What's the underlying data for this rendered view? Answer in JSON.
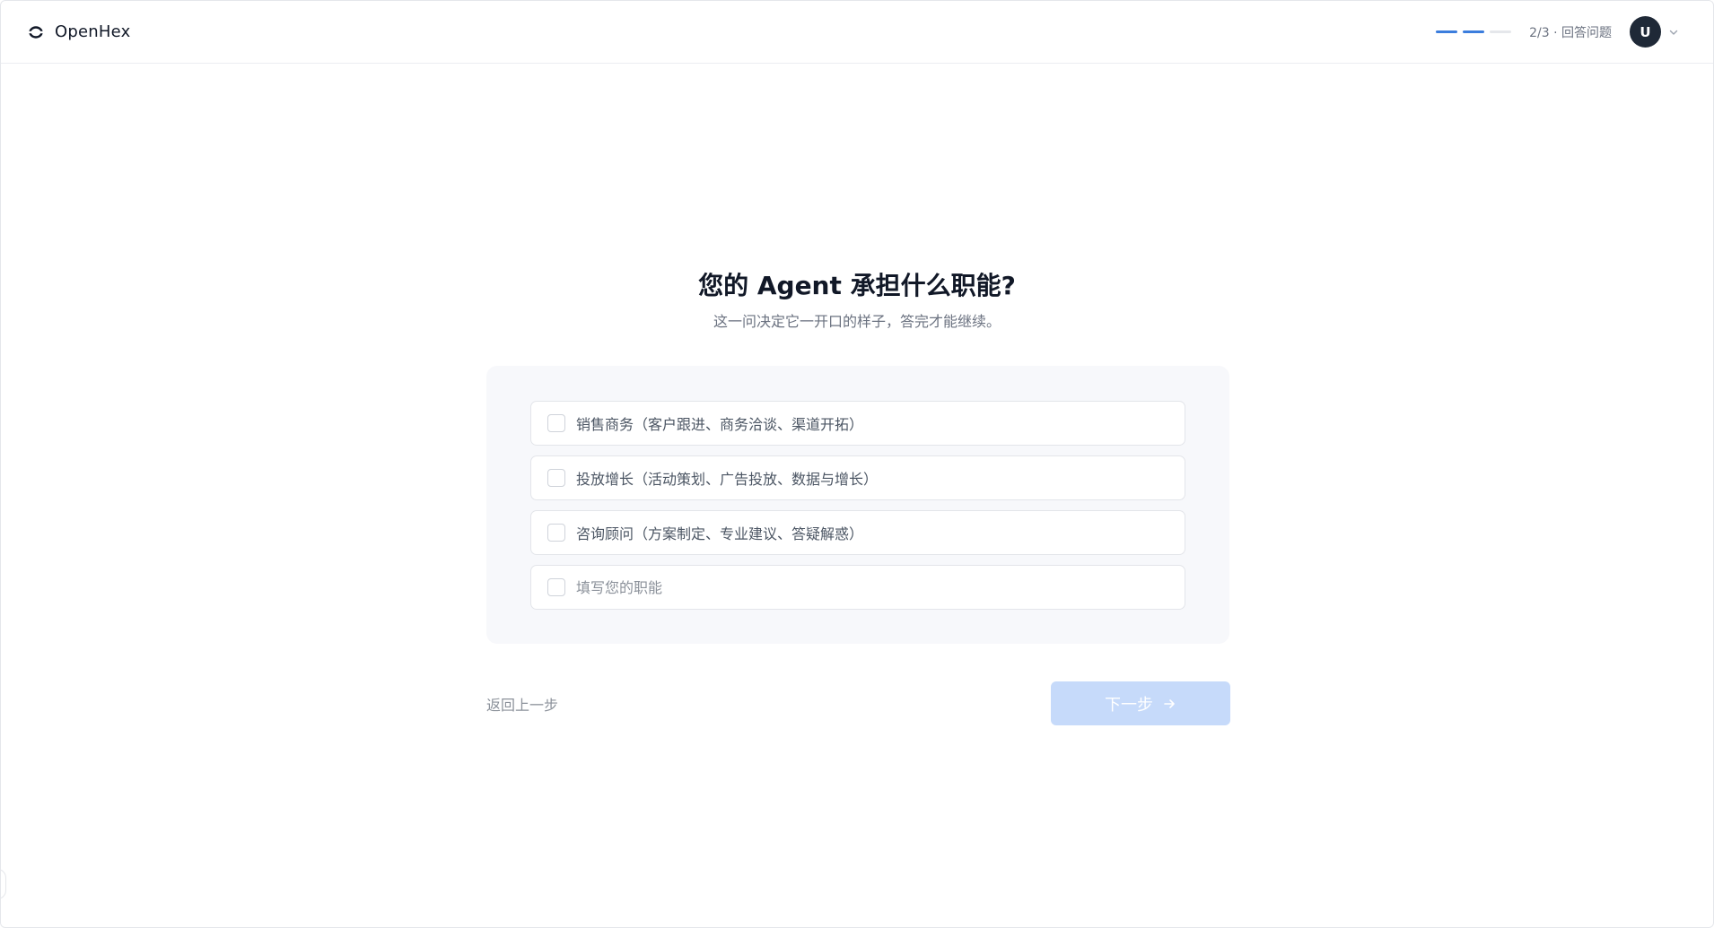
{
  "app": {
    "name": "OpenHex"
  },
  "header": {
    "progress": {
      "current": 2,
      "total": 3
    },
    "step_text": "2/3 · 回答问题",
    "avatar_initial": "U"
  },
  "question": {
    "title": "您的 Agent 承担什么职能?",
    "subtitle": "这一问决定它一开口的样子，答完才能继续。"
  },
  "options": [
    {
      "label": "销售商务（客户跟进、商务洽谈、渠道开拓）"
    },
    {
      "label": "投放增长（活动策划、广告投放、数据与增长）"
    },
    {
      "label": "咨询顾问（方案制定、专业建议、答疑解惑）"
    }
  ],
  "custom_option": {
    "value": "",
    "placeholder": "填写您的职能"
  },
  "footer": {
    "back_label": "返回上一步",
    "next_label": "下一步"
  },
  "colors": {
    "accent": "#3b7ddd",
    "next_disabled": "#c6dafa"
  },
  "icons": [
    "openhex-logo-icon",
    "chevron-down-icon",
    "arrow-right-icon"
  ]
}
